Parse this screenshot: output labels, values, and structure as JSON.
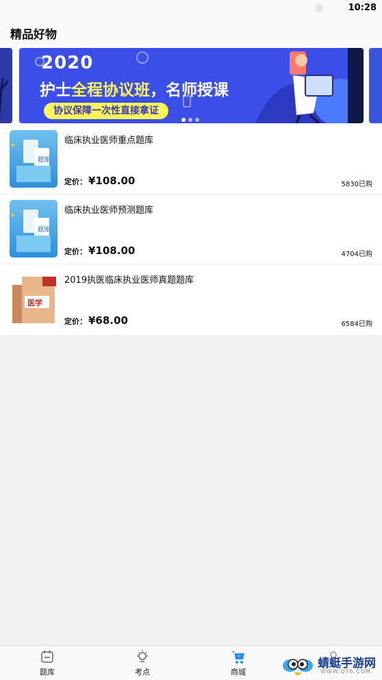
{
  "status": {
    "time": "10:28"
  },
  "header": {
    "title": "精品好物"
  },
  "banner": {
    "year": "2020",
    "title_pre": "护士",
    "title_highlight": "全程协议班",
    "title_post": "，名师授课",
    "pill_text": "协议保障一次性直接拿证",
    "colors": {
      "background": "#3b4ee8",
      "highlight": "#fff35a"
    }
  },
  "products": [
    {
      "name": "临床执业医师重点题库",
      "price_label": "定价：",
      "price": "¥108.00",
      "sales": "5830已购",
      "thumb": "题库"
    },
    {
      "name": "临床执业医师预测题库",
      "price_label": "定价：",
      "price": "¥108.00",
      "sales": "4704已购",
      "thumb": "题库"
    },
    {
      "name": "2019执医临床执业医师真题题库",
      "price_label": "定价：",
      "price": "¥68.00",
      "sales": "6584已购",
      "thumb": "医学"
    }
  ],
  "nav": {
    "items": [
      {
        "label": "题库",
        "icon": "calendar-icon"
      },
      {
        "label": "考点",
        "icon": "lightbulb-icon"
      },
      {
        "label": "商城",
        "icon": "shopping-cart-icon",
        "active": true
      },
      {
        "label": "",
        "icon": "user-icon"
      }
    ]
  },
  "watermark": {
    "title": "蜻蜓手游网",
    "url": "WWW.QT6.COM"
  }
}
